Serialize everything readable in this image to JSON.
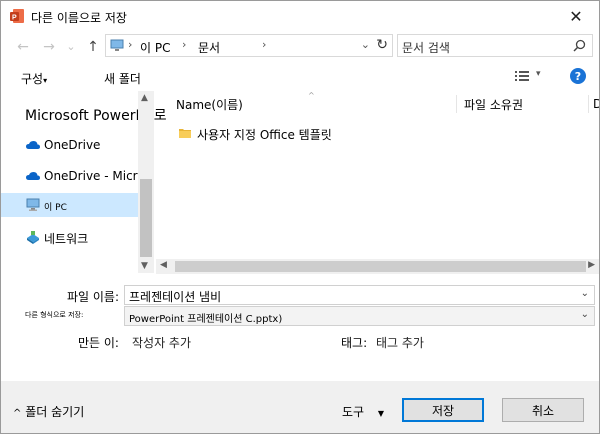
{
  "window": {
    "title": "다른 이름으로 저장",
    "close_glyph": "✕"
  },
  "nav": {
    "back_glyph": "←",
    "forward_glyph": "→",
    "recent_glyph": "⌄",
    "up_glyph": "↑",
    "breadcrumb": [
      "이 PC",
      "문서"
    ],
    "sep_glyph": "›",
    "dropdown_glyph": "⌄",
    "refresh_glyph": "↻",
    "search_placeholder": "문서 검색"
  },
  "toolbar": {
    "organize": "구성",
    "organize_glyph": "▾",
    "new_folder": "새 폴더",
    "view_drop_glyph": "▾",
    "help": "?"
  },
  "sidebar": {
    "top_label": "Microsoft PowerPC로",
    "items": [
      {
        "label": "OneDrive",
        "icon": "cloud-icon"
      },
      {
        "label": "OneDrive - Micros",
        "icon": "cloud-icon"
      },
      {
        "label": "이 PC",
        "icon": "computer-icon",
        "selected": true
      },
      {
        "label": "네트워크",
        "icon": "network-icon"
      }
    ]
  },
  "filelist": {
    "columns": [
      "Name(이름)",
      "파일 소유권",
      "D"
    ],
    "sort_glyph": "^",
    "rows": [
      {
        "name": "사용자 지정 Office 템플릿",
        "icon": "folder-icon"
      }
    ]
  },
  "form": {
    "filename_label": "파일 이름:",
    "filename_value": "프레젠테이션 냄비",
    "filetype_label": "다른 형식으로 저장:",
    "filetype_value": "PowerPoint 프레젠테이션 C.pptx)",
    "author_label": "만든 이:",
    "author_value": "작성자 추가",
    "tags_label": "태그:",
    "tags_value": "태그 추가"
  },
  "footer": {
    "hide_folders": "폴더 숨기기",
    "hide_glyph": "^",
    "tools": "도구",
    "tools_glyph": "▼",
    "save": "저장",
    "cancel": "취소"
  },
  "colors": {
    "accent": "#0078d7",
    "selected_bg": "#cce8ff",
    "powerpoint": "#d24726"
  }
}
